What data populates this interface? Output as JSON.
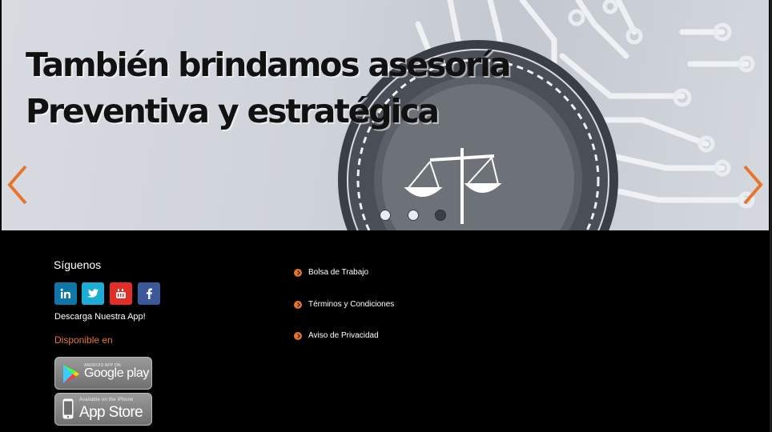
{
  "hero": {
    "title_line1": "También brindamos asesoría",
    "title_line2": "Preventiva y estratégica",
    "accent_color": "#e8742b",
    "prev_icon": "chevron-left-icon",
    "next_icon": "chevron-right-icon",
    "slides_total": 3,
    "active_slide": 3,
    "background_icon": "scales-of-justice-icon"
  },
  "footer": {
    "follow_label": "Síguenos",
    "social": [
      {
        "name": "linkedin",
        "icon": "linkedin-icon",
        "color": "#0e76a8"
      },
      {
        "name": "twitter",
        "icon": "twitter-icon",
        "color": "#1dadd4"
      },
      {
        "name": "youtube",
        "icon": "youtube-icon",
        "color": "#e52d27"
      },
      {
        "name": "facebook",
        "icon": "facebook-icon",
        "color": "#3b5998"
      }
    ],
    "download_label": "Descarga Nuestra App!",
    "available_label": "Disponible en",
    "google_play": {
      "small": "ANDROID APP ON",
      "big": "Google play"
    },
    "app_store": {
      "small": "Available on the iPhone",
      "big": "App Store"
    },
    "links": [
      {
        "label": "Bolsa de Trabajo"
      },
      {
        "label": "Términos y Condiciones"
      },
      {
        "label": "Aviso de Privacidad"
      }
    ],
    "link_bullet_icon": "arrow-circle-right-icon"
  }
}
